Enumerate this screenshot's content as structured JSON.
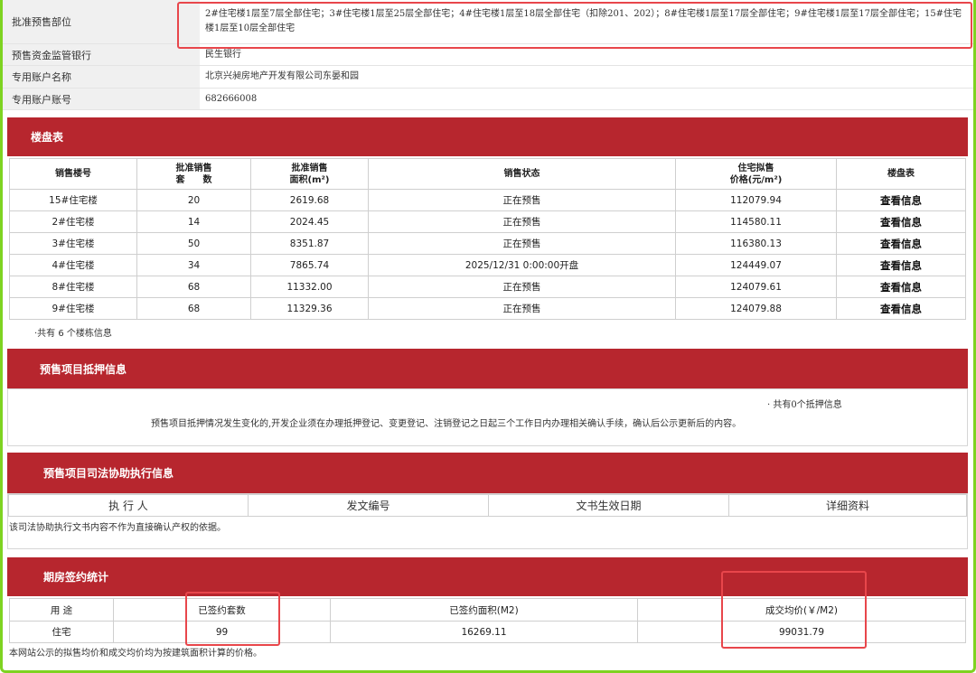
{
  "info": {
    "rows": [
      {
        "label": "批准预售部位",
        "value": "2#住宅楼1层至7层全部住宅；3#住宅楼1层至25层全部住宅；4#住宅楼1层至18层全部住宅（扣除201、202）；8#住宅楼1层至17层全部住宅；9#住宅楼1层至17层全部住宅；15#住宅楼1层至10层全部住宅"
      },
      {
        "label": "预售资金监管银行",
        "value": "民生银行"
      },
      {
        "label": "专用账户名称",
        "value": "北京兴昶房地产开发有限公司东晏和园"
      },
      {
        "label": "专用账户账号",
        "value": "682666008"
      }
    ]
  },
  "loupan": {
    "title": "楼盘表",
    "headers": {
      "building": "销售楼号",
      "units_1": "批准销售",
      "units_2": "套　　数",
      "area_1": "批准销售",
      "area_2": "面积(m²)",
      "status": "销售状态",
      "price_1": "住宅拟售",
      "price_2": "价格(元/m²)",
      "table": "楼盘表"
    },
    "rows": [
      {
        "building": "15#住宅楼",
        "units": "20",
        "area": "2619.68",
        "status": "正在预售",
        "price": "112079.94",
        "link": "查看信息"
      },
      {
        "building": "2#住宅楼",
        "units": "14",
        "area": "2024.45",
        "status": "正在预售",
        "price": "114580.11",
        "link": "查看信息"
      },
      {
        "building": "3#住宅楼",
        "units": "50",
        "area": "8351.87",
        "status": "正在预售",
        "price": "116380.13",
        "link": "查看信息"
      },
      {
        "building": "4#住宅楼",
        "units": "34",
        "area": "7865.74",
        "status": "2025/12/31 0:00:00开盘",
        "price": "124449.07",
        "link": "查看信息"
      },
      {
        "building": "8#住宅楼",
        "units": "68",
        "area": "11332.00",
        "status": "正在预售",
        "price": "124079.61",
        "link": "查看信息"
      },
      {
        "building": "9#住宅楼",
        "units": "68",
        "area": "11329.36",
        "status": "正在预售",
        "price": "124079.88",
        "link": "查看信息"
      }
    ],
    "count_text": "·共有 6 个楼栋信息"
  },
  "mortgage": {
    "title": "预售项目抵押信息",
    "count_text": "· 共有0个抵押信息",
    "note": "预售项目抵押情况发生变化的,开发企业须在办理抵押登记、变更登记、注销登记之日起三个工作日内办理相关确认手续，确认后公示更新后的内容。"
  },
  "judicial": {
    "title": "预售项目司法协助执行信息",
    "headers": [
      "执 行 人",
      "发文编号",
      "文书生效日期",
      "详细资料"
    ],
    "note": "该司法协助执行文书内容不作为直接确认产权的依据。"
  },
  "qifang": {
    "title": "期房签约统计",
    "headers": [
      "用 途",
      "已签约套数",
      "已签约面积(M2)",
      "成交均价(￥/M2)"
    ],
    "row": [
      "住宅",
      "99",
      "16269.11",
      "99031.79"
    ],
    "note": "本网站公示的拟售均价和成交均价均为按建筑面积计算的价格。"
  },
  "colors": {
    "header_red": "#b7262e",
    "highlight_box": "#e8464b",
    "outer_border": "#7ed321"
  }
}
